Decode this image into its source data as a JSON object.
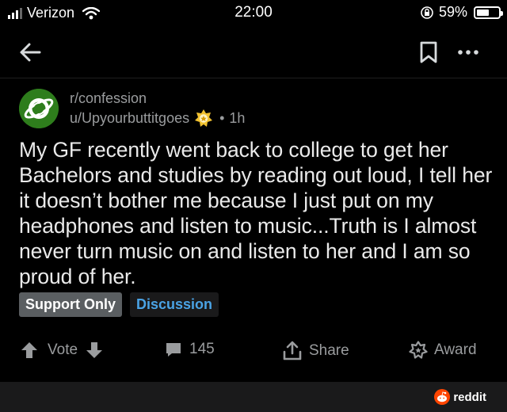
{
  "status_bar": {
    "carrier": "Verizon",
    "time": "22:00",
    "battery_percent": "59%",
    "battery_level": 0.59
  },
  "nav": {
    "back_icon": "arrow-left-icon",
    "bookmark_icon": "bookmark-icon",
    "more_icon": "more-horizontal-icon"
  },
  "post": {
    "subreddit": "r/confession",
    "username": "u/Upyourbuttitgoes",
    "time_ago": "1h",
    "title": "My GF recently went back to college to get her Bachelors and studies by reading out loud, I tell her it doesn’t bother me because I just put on my headphones and listen to music...Truth is I almost never turn music on and listen to her and I am so proud of her.",
    "flairs": [
      "Support Only",
      "Discussion"
    ]
  },
  "actions": {
    "vote_label": "Vote",
    "comments_count": "145",
    "share_label": "Share",
    "award_label": "Award"
  },
  "footer": {
    "brand": "reddit"
  },
  "colors": {
    "background": "#000000",
    "subreddit_avatar": "#2e7d1c",
    "flair_support": "#5a5e61",
    "flair_discussion_text": "#4aa3e5",
    "reddit_orange": "#ff4500"
  }
}
